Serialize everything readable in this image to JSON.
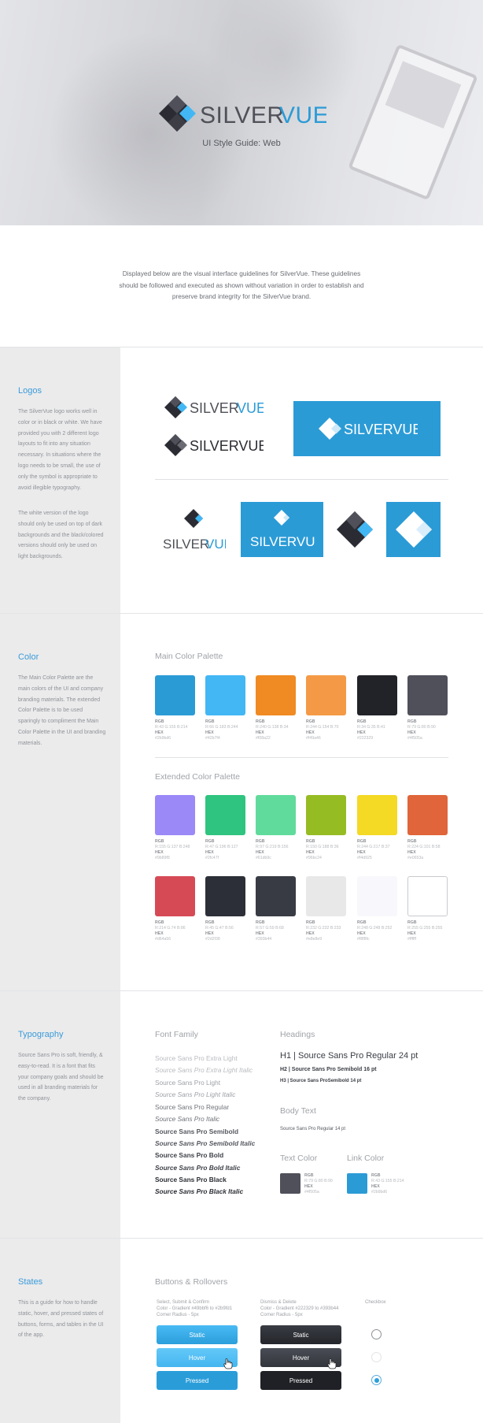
{
  "hero": {
    "brand_silver": "SILVER",
    "brand_vue": "VUE",
    "subtitle": "UI Style Guide: Web"
  },
  "intro": {
    "text": "Displayed below are the visual interface guidelines for SilverVue. These guidelines should be followed and executed as shown without variation in order to establish and preserve brand integrity for the SilverVue brand."
  },
  "logos": {
    "title": "Logos",
    "paragraph1": "The SilverVue logo works well in color or in black or white. We have provided you with 2 different logo layouts to fit into any situation necessary. In situations where the logo needs to be small, the use of only the symbol is appropriate to avoid illegible typography.",
    "paragraph2": "The white version of the logo should only be used on top of dark backgrounds and the black/colored versions should only be used on light backgrounds.",
    "brand_silver": "SILVER",
    "brand_vue": "VUE",
    "brand_full": "SILVERVUE"
  },
  "color": {
    "title": "Color",
    "description": "The Main Color Palette are the main colors of the UI and company branding materials. The extended Color Palette is to be used sparingly to compliment the Main Color Palette in the UI and branding materials.",
    "main_title": "Main Color Palette",
    "extended_title": "Extended Color Palette",
    "rgb_label": "RGB",
    "hex_label": "HEX",
    "main": [
      {
        "color": "#2b9bd6",
        "rgb": "R:43 G:155 B:214",
        "hex": "#2b9bd6"
      },
      {
        "color": "#42b7f4",
        "rgb": "R:66 G:183 B:244",
        "hex": "#42b7f4"
      },
      {
        "color": "#f08a22",
        "rgb": "R:240 G:138 B:34",
        "hex": "#f08a22"
      },
      {
        "color": "#f49a46",
        "rgb": "R:244 G:154 B:70",
        "hex": "#f49a46"
      },
      {
        "color": "#222329",
        "rgb": "R:34 G:35 B:41",
        "hex": "#222329"
      },
      {
        "color": "#4f505a",
        "rgb": "R:79 G:80 B:90",
        "hex": "#4f505a"
      }
    ],
    "extended_row1": [
      {
        "color": "#9b89f8",
        "rgb": "R:155 G:137 B:248",
        "hex": "#9b89f8"
      },
      {
        "color": "#2fc47f",
        "rgb": "R:47 G:196 B:127",
        "hex": "#2fc47f"
      },
      {
        "color": "#61db9c",
        "rgb": "R:97 G:219 B:156",
        "hex": "#61db9c"
      },
      {
        "color": "#96bc24",
        "rgb": "R:150 G:188 B:36",
        "hex": "#96bc24"
      },
      {
        "color": "#f4d925",
        "rgb": "R:244 G:217 B:37",
        "hex": "#f4d925"
      },
      {
        "color": "#e0653a",
        "rgb": "R:224 G:101 B:58",
        "hex": "#e0653a"
      }
    ],
    "extended_row2": [
      {
        "color": "#d64a56",
        "rgb": "R:214 G:74 B:86",
        "hex": "#d64a56"
      },
      {
        "color": "#2d2f38",
        "rgb": "R:45 G:47 B:56",
        "hex": "#2d2f38"
      },
      {
        "color": "#393b44",
        "rgb": "R:57 G:59 B:68",
        "hex": "#393b44"
      },
      {
        "color": "#e8e8e9",
        "rgb": "R:232 G:232 B:233",
        "hex": "#e8e8e9"
      },
      {
        "color": "#f8f8fc",
        "rgb": "R:248 G:248 B:252",
        "hex": "#f8f8fc"
      },
      {
        "color": "#ffffff",
        "rgb": "R:255 G:255 B:255",
        "hex": "#ffffff"
      }
    ]
  },
  "typography": {
    "title": "Typography",
    "description": "Source Sans Pro is soft, friendly, & easy-to-read. It is a font that fits your company goals and should be used in all branding materials for the company.",
    "font_family_title": "Font Family",
    "fonts": [
      "Source Sans Pro Extra Light",
      "Source Sans Pro Extra Light Italic",
      "Source Sans Pro Light",
      "Source Sans Pro Light Italic",
      "Source Sans Pro Regular",
      "Source Sans Pro Italic",
      "Source Sans Pro Semibold",
      "Source Sans Pro Semibold Italic",
      "Source Sans Pro Bold",
      "Source Sans Pro Bold Italic",
      "Source Sans Pro Black",
      "Source Sans Pro Black Italic"
    ],
    "headings_title": "Headings",
    "h1": "H1 | Source Sans Pro Regular 24 pt",
    "h2": "H2 | Source Sans Pro Semibold 16 pt",
    "h3": "H3 | Source Sans ProSemibold 14 pt",
    "body_title": "Body Text",
    "body_sample": "Source Sans Pro Regular 14 pt",
    "text_color_title": "Text Color",
    "link_color_title": "Link Color",
    "text_color": {
      "color": "#4f505a",
      "rgb": "R:79 G:80 B:90",
      "hex": "#4f505a"
    },
    "link_color": {
      "color": "#2b9bd6",
      "rgb": "R:43 G:155 B:214",
      "hex": "#2b9bd6"
    }
  },
  "states": {
    "title": "States",
    "description": "This is a guide for how to handle static, hover, and pressed states of buttons, forms, and tables in the UI of the app.",
    "buttons_title": "Buttons & Rollovers",
    "blue_spec_1": "Select, Submit & Confirm",
    "blue_spec_2": "Color - Gradient #49bbf6 to #2b9fd1",
    "blue_spec_3": "Corner Radius - 5px",
    "dark_spec_1": "Dismiss & Delete",
    "dark_spec_2": "Color - Gradient #222329 to #393b44",
    "dark_spec_3": "Corner Radius - 5px",
    "checkbox_title": "Checkbox",
    "static": "Static",
    "hover": "Hover",
    "pressed": "Pressed"
  }
}
